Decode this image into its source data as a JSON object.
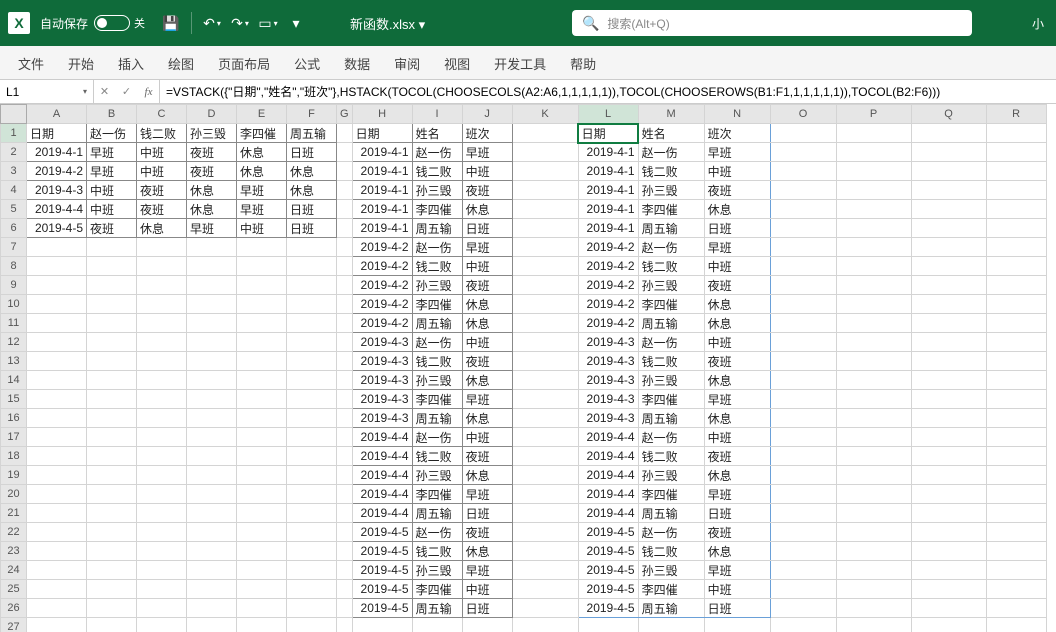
{
  "titlebar": {
    "autosave_label": "自动保存",
    "off_label": "关",
    "filename": "新函数.xlsx  ▾",
    "search_placeholder": "搜索(Alt+Q)",
    "right_text": "小"
  },
  "ribbon": {
    "tabs": [
      "文件",
      "开始",
      "插入",
      "绘图",
      "页面布局",
      "公式",
      "数据",
      "审阅",
      "视图",
      "开发工具",
      "帮助"
    ]
  },
  "formula_bar": {
    "name_box": "L1",
    "formula": "=VSTACK({\"日期\",\"姓名\",\"班次\"},HSTACK(TOCOL(CHOOSECOLS(A2:A6,1,1,1,1,1)),TOCOL(CHOOSEROWS(B1:F1,1,1,1,1,1)),TOCOL(B2:F6)))"
  },
  "columns": [
    "A",
    "B",
    "C",
    "D",
    "E",
    "F",
    "G",
    "H",
    "I",
    "J",
    "K",
    "L",
    "M",
    "N",
    "O",
    "P",
    "Q",
    "R"
  ],
  "row_count": 27,
  "selected_cell": "L1",
  "selected_col": "L",
  "selected_row": 1,
  "tableA": {
    "header_row": [
      "日期",
      "赵一伤",
      "钱二败",
      "孙三毁",
      "李四催",
      "周五输"
    ],
    "rows": [
      [
        "2019-4-1",
        "早班",
        "中班",
        "夜班",
        "休息",
        "日班"
      ],
      [
        "2019-4-2",
        "早班",
        "中班",
        "夜班",
        "休息",
        "休息"
      ],
      [
        "2019-4-3",
        "中班",
        "夜班",
        "休息",
        "早班",
        "休息"
      ],
      [
        "2019-4-4",
        "中班",
        "夜班",
        "休息",
        "早班",
        "日班"
      ],
      [
        "2019-4-5",
        "夜班",
        "休息",
        "早班",
        "中班",
        "日班"
      ]
    ]
  },
  "tableH": {
    "header": [
      "日期",
      "姓名",
      "班次"
    ],
    "rows": [
      [
        "2019-4-1",
        "赵一伤",
        "早班"
      ],
      [
        "2019-4-1",
        "钱二败",
        "中班"
      ],
      [
        "2019-4-1",
        "孙三毁",
        "夜班"
      ],
      [
        "2019-4-1",
        "李四催",
        "休息"
      ],
      [
        "2019-4-1",
        "周五输",
        "日班"
      ],
      [
        "2019-4-2",
        "赵一伤",
        "早班"
      ],
      [
        "2019-4-2",
        "钱二败",
        "中班"
      ],
      [
        "2019-4-2",
        "孙三毁",
        "夜班"
      ],
      [
        "2019-4-2",
        "李四催",
        "休息"
      ],
      [
        "2019-4-2",
        "周五输",
        "休息"
      ],
      [
        "2019-4-3",
        "赵一伤",
        "中班"
      ],
      [
        "2019-4-3",
        "钱二败",
        "夜班"
      ],
      [
        "2019-4-3",
        "孙三毁",
        "休息"
      ],
      [
        "2019-4-3",
        "李四催",
        "早班"
      ],
      [
        "2019-4-3",
        "周五输",
        "休息"
      ],
      [
        "2019-4-4",
        "赵一伤",
        "中班"
      ],
      [
        "2019-4-4",
        "钱二败",
        "夜班"
      ],
      [
        "2019-4-4",
        "孙三毁",
        "休息"
      ],
      [
        "2019-4-4",
        "李四催",
        "早班"
      ],
      [
        "2019-4-4",
        "周五输",
        "日班"
      ],
      [
        "2019-4-5",
        "赵一伤",
        "夜班"
      ],
      [
        "2019-4-5",
        "钱二败",
        "休息"
      ],
      [
        "2019-4-5",
        "孙三毁",
        "早班"
      ],
      [
        "2019-4-5",
        "李四催",
        "中班"
      ],
      [
        "2019-4-5",
        "周五输",
        "日班"
      ]
    ]
  },
  "tableL": {
    "header": [
      "日期",
      "姓名",
      "班次"
    ],
    "rows": [
      [
        "2019-4-1",
        "赵一伤",
        "早班"
      ],
      [
        "2019-4-1",
        "钱二败",
        "中班"
      ],
      [
        "2019-4-1",
        "孙三毁",
        "夜班"
      ],
      [
        "2019-4-1",
        "李四催",
        "休息"
      ],
      [
        "2019-4-1",
        "周五输",
        "日班"
      ],
      [
        "2019-4-2",
        "赵一伤",
        "早班"
      ],
      [
        "2019-4-2",
        "钱二败",
        "中班"
      ],
      [
        "2019-4-2",
        "孙三毁",
        "夜班"
      ],
      [
        "2019-4-2",
        "李四催",
        "休息"
      ],
      [
        "2019-4-2",
        "周五输",
        "休息"
      ],
      [
        "2019-4-3",
        "赵一伤",
        "中班"
      ],
      [
        "2019-4-3",
        "钱二败",
        "夜班"
      ],
      [
        "2019-4-3",
        "孙三毁",
        "休息"
      ],
      [
        "2019-4-3",
        "李四催",
        "早班"
      ],
      [
        "2019-4-3",
        "周五输",
        "休息"
      ],
      [
        "2019-4-4",
        "赵一伤",
        "中班"
      ],
      [
        "2019-4-4",
        "钱二败",
        "夜班"
      ],
      [
        "2019-4-4",
        "孙三毁",
        "休息"
      ],
      [
        "2019-4-4",
        "李四催",
        "早班"
      ],
      [
        "2019-4-4",
        "周五输",
        "日班"
      ],
      [
        "2019-4-5",
        "赵一伤",
        "夜班"
      ],
      [
        "2019-4-5",
        "钱二败",
        "休息"
      ],
      [
        "2019-4-5",
        "孙三毁",
        "早班"
      ],
      [
        "2019-4-5",
        "李四催",
        "中班"
      ],
      [
        "2019-4-5",
        "周五输",
        "日班"
      ]
    ]
  }
}
